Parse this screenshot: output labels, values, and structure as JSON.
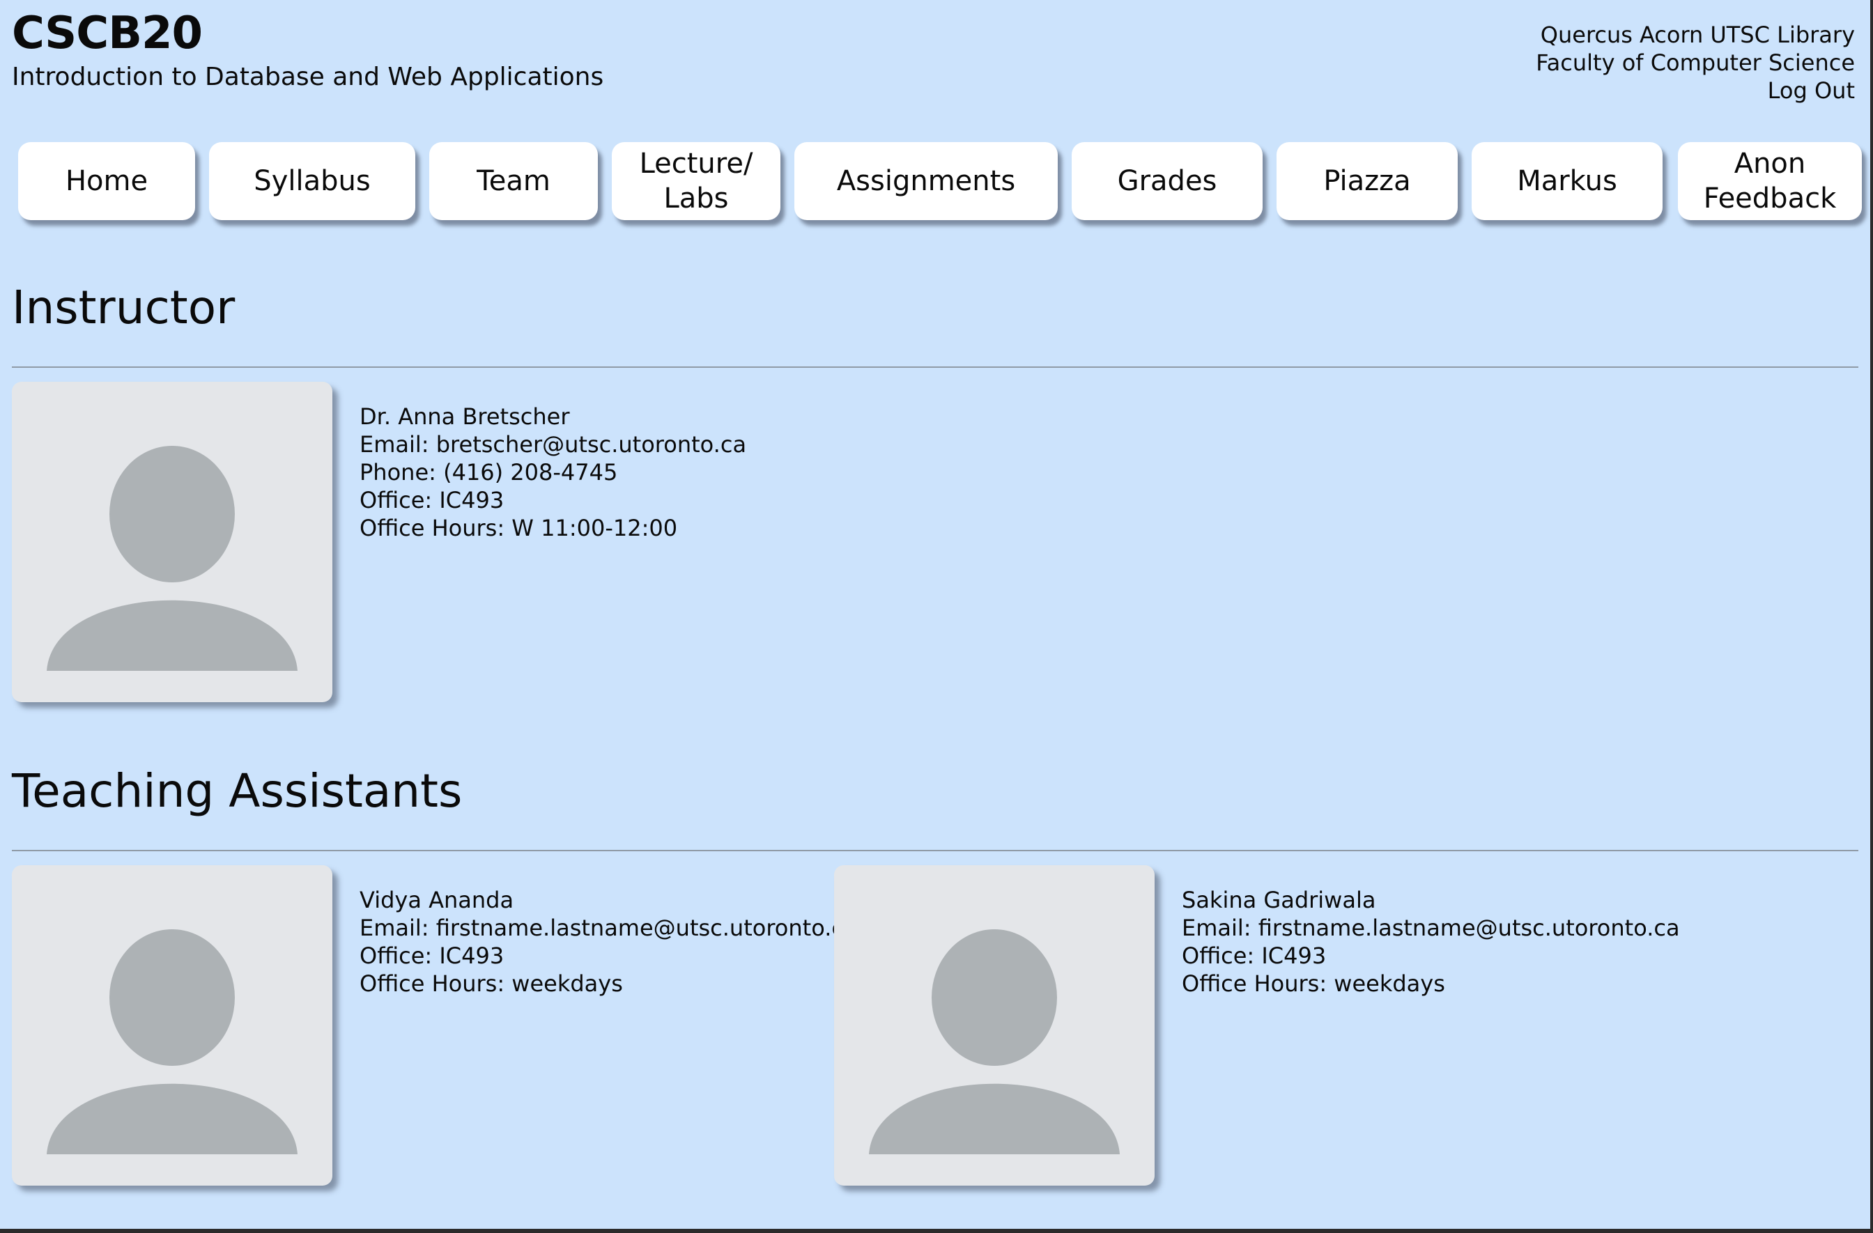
{
  "header": {
    "title": "CSCB20",
    "subtitle": "Introduction to Database and Web Applications",
    "links_row1": [
      "Quercus",
      "Acorn",
      "UTSC Library"
    ],
    "links_row2": "Faculty of Computer Science",
    "links_row3": "Log Out"
  },
  "nav": {
    "home": "Home",
    "syllabus": "Syllabus",
    "team": "Team",
    "lecture_labs_l1": "Lecture/",
    "lecture_labs_l2": "Labs",
    "assignments": "Assignments",
    "grades": "Grades",
    "piazza": "Piazza",
    "markus": "Markus",
    "anon_l1": "Anon",
    "anon_l2": "Feedback"
  },
  "instructor": {
    "heading": "Instructor",
    "name": "Dr. Anna Bretscher",
    "email": "Email: bretscher@utsc.utoronto.ca",
    "phone": "Phone: (416) 208-4745",
    "office": "Office: IC493",
    "hours": "Office Hours: W 11:00-12:00"
  },
  "tas": {
    "heading": "Teaching Assistants",
    "list": [
      {
        "name": "Vidya Ananda",
        "email": "Email: firstname.lastname@utsc.utoronto.ca",
        "office": "Office: IC493",
        "hours": "Office Hours: weekdays"
      },
      {
        "name": "Sakina Gadriwala",
        "email": "Email: firstname.lastname@utsc.utoronto.ca",
        "office": "Office: IC493",
        "hours": "Office Hours: weekdays"
      }
    ]
  },
  "colors": {
    "background": "#cce3fc",
    "button": "#ffffff",
    "avatar_bg": "#e4e6e9",
    "avatar_figure": "#adb2b5"
  }
}
